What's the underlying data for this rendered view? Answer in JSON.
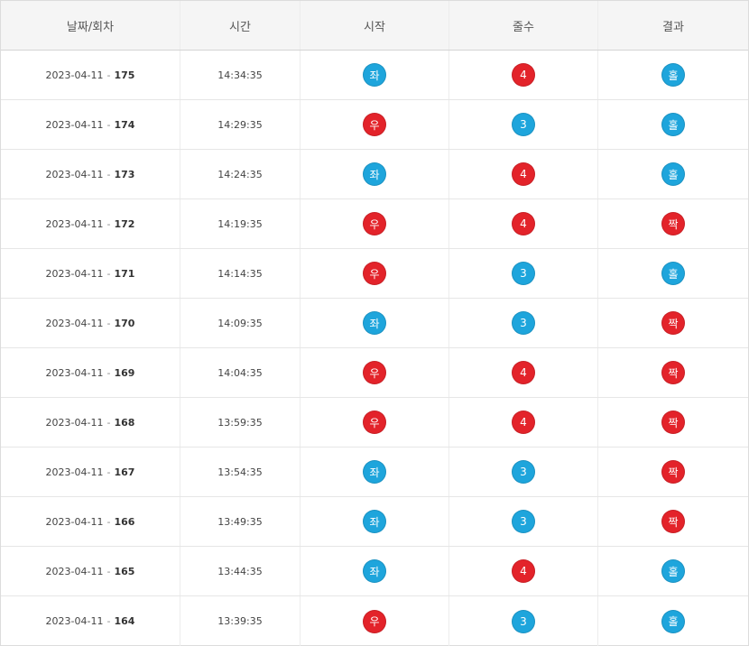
{
  "colors": {
    "blue": "#1ea5dc",
    "red": "#e3232a",
    "header_bg": "#f5f5f5"
  },
  "headers": {
    "date_round": "날짜/회차",
    "time": "시간",
    "start": "시작",
    "lines": "줄수",
    "result": "결과"
  },
  "separator": "-",
  "rows": [
    {
      "date": "2023-04-11",
      "round": "175",
      "time": "14:34:35",
      "start": "좌",
      "start_color": "blue",
      "lines": "4",
      "lines_color": "red",
      "result": "홀",
      "result_color": "blue"
    },
    {
      "date": "2023-04-11",
      "round": "174",
      "time": "14:29:35",
      "start": "우",
      "start_color": "red",
      "lines": "3",
      "lines_color": "blue",
      "result": "홀",
      "result_color": "blue"
    },
    {
      "date": "2023-04-11",
      "round": "173",
      "time": "14:24:35",
      "start": "좌",
      "start_color": "blue",
      "lines": "4",
      "lines_color": "red",
      "result": "홀",
      "result_color": "blue"
    },
    {
      "date": "2023-04-11",
      "round": "172",
      "time": "14:19:35",
      "start": "우",
      "start_color": "red",
      "lines": "4",
      "lines_color": "red",
      "result": "짝",
      "result_color": "red"
    },
    {
      "date": "2023-04-11",
      "round": "171",
      "time": "14:14:35",
      "start": "우",
      "start_color": "red",
      "lines": "3",
      "lines_color": "blue",
      "result": "홀",
      "result_color": "blue"
    },
    {
      "date": "2023-04-11",
      "round": "170",
      "time": "14:09:35",
      "start": "좌",
      "start_color": "blue",
      "lines": "3",
      "lines_color": "blue",
      "result": "짝",
      "result_color": "red"
    },
    {
      "date": "2023-04-11",
      "round": "169",
      "time": "14:04:35",
      "start": "우",
      "start_color": "red",
      "lines": "4",
      "lines_color": "red",
      "result": "짝",
      "result_color": "red"
    },
    {
      "date": "2023-04-11",
      "round": "168",
      "time": "13:59:35",
      "start": "우",
      "start_color": "red",
      "lines": "4",
      "lines_color": "red",
      "result": "짝",
      "result_color": "red"
    },
    {
      "date": "2023-04-11",
      "round": "167",
      "time": "13:54:35",
      "start": "좌",
      "start_color": "blue",
      "lines": "3",
      "lines_color": "blue",
      "result": "짝",
      "result_color": "red"
    },
    {
      "date": "2023-04-11",
      "round": "166",
      "time": "13:49:35",
      "start": "좌",
      "start_color": "blue",
      "lines": "3",
      "lines_color": "blue",
      "result": "짝",
      "result_color": "red"
    },
    {
      "date": "2023-04-11",
      "round": "165",
      "time": "13:44:35",
      "start": "좌",
      "start_color": "blue",
      "lines": "4",
      "lines_color": "red",
      "result": "홀",
      "result_color": "blue"
    },
    {
      "date": "2023-04-11",
      "round": "164",
      "time": "13:39:35",
      "start": "우",
      "start_color": "red",
      "lines": "3",
      "lines_color": "blue",
      "result": "홀",
      "result_color": "blue"
    }
  ]
}
